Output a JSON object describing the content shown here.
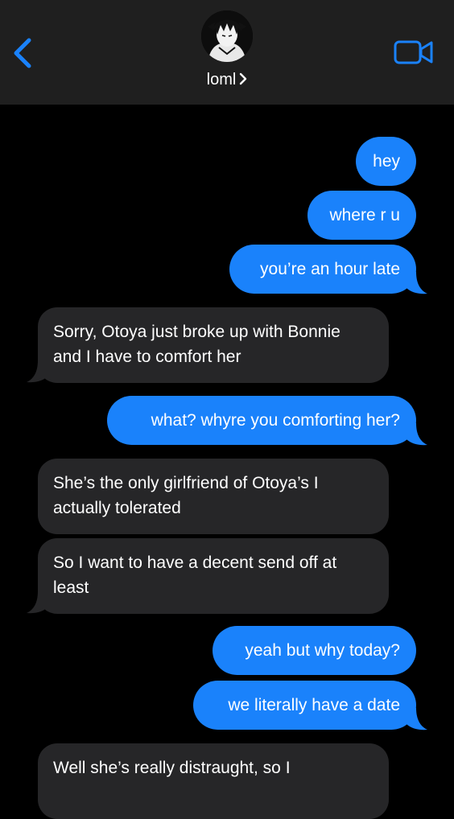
{
  "header": {
    "contact_name": "loml",
    "back_icon": "chevron-left-icon",
    "video_icon": "video-camera-icon",
    "accent_color": "#1a82fb"
  },
  "messages": [
    {
      "from": "me",
      "text": "hey"
    },
    {
      "from": "me",
      "text": "where r u"
    },
    {
      "from": "me",
      "text": "you’re an hour late"
    },
    {
      "from": "them",
      "text": "Sorry, Otoya just broke up with Bonnie and I have to comfort her"
    },
    {
      "from": "me",
      "text": "what? whyre you comforting her?"
    },
    {
      "from": "them",
      "text": "She’s the only girlfriend of Otoya’s I actually tolerated"
    },
    {
      "from": "them",
      "text": "So I want to have a decent send off at least"
    },
    {
      "from": "me",
      "text": "yeah but why today?"
    },
    {
      "from": "me",
      "text": "we literally have a date"
    },
    {
      "from": "them",
      "text": "Well she’s really distraught, so I"
    }
  ],
  "colors": {
    "sent_bubble": "#1a82fb",
    "received_bubble": "#262628",
    "background": "#000000",
    "header": "#1f1f1f"
  }
}
